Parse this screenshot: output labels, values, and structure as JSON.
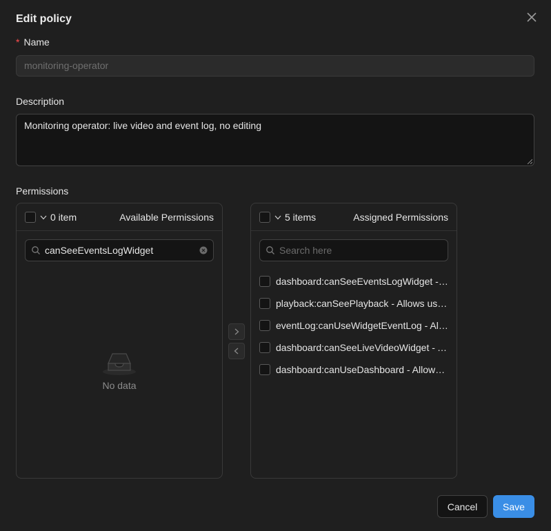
{
  "dialog": {
    "title": "Edit policy",
    "close_icon": "close-icon"
  },
  "form": {
    "name_required_mark": "*",
    "name_label": "Name",
    "name_value": "monitoring-operator",
    "description_label": "Description",
    "description_value": "Monitoring operator: live video and event log, no editing",
    "permissions_label": "Permissions"
  },
  "available": {
    "count": "0 item",
    "title": "Available Permissions",
    "search_value": "canSeeEventsLogWidget",
    "empty_text": "No data"
  },
  "assigned": {
    "count": "5 items",
    "title": "Assigned Permissions",
    "search_placeholder": "Search here",
    "items": [
      "dashboard:canSeeEventsLogWidget - Allows user to see events log widget",
      "playback:canSeePlayback - Allows user to see playback",
      "eventLog:canUseWidgetEventLog - Allows user to use widget event log",
      "dashboard:canSeeLiveVideoWidget - Allows user to see live video widget",
      "dashboard:canUseDashboard - Allows user to use dashboard"
    ]
  },
  "transfer": {
    "to_right": ">",
    "to_left": "<"
  },
  "footer": {
    "cancel_label": "Cancel",
    "save_label": "Save"
  },
  "colors": {
    "primary": "#3a8ee6",
    "background": "#1f1f1f",
    "required": "#ff4d4f"
  }
}
